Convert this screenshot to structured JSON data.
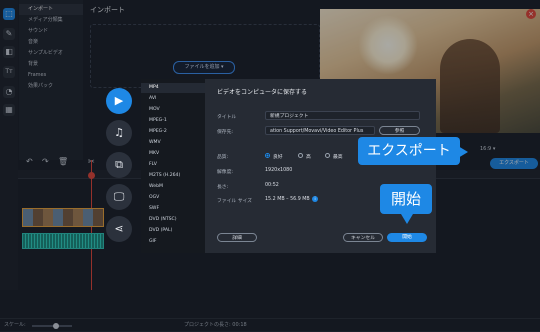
{
  "rail": {
    "items": [
      {
        "icon": "import-icon",
        "glyph": "⬚"
      },
      {
        "icon": "magic-icon",
        "glyph": "✎"
      },
      {
        "icon": "filter-icon",
        "glyph": "◧"
      },
      {
        "icon": "text-icon",
        "glyph": "Tт"
      },
      {
        "icon": "sticker-icon",
        "glyph": "◔"
      },
      {
        "icon": "more-icon",
        "glyph": "▦"
      }
    ]
  },
  "categories": [
    "インポート",
    "メディア分類集",
    "サウンド",
    "音楽",
    "サンプルビデオ",
    "背景",
    "Frames",
    "効果パック"
  ],
  "import": {
    "title": "インポート",
    "add_file": "ファイルを追加 ▾"
  },
  "timeline": {
    "tools": [
      "↶",
      "↷",
      "🗑",
      "✂"
    ],
    "ratio": "16:9 ▾",
    "export_label": "エクスポート",
    "scale_label": "スケール:",
    "duration_label": "プロジェクトの長さ: 00:18"
  },
  "dialog": {
    "export_types": [
      {
        "icon": "video-icon",
        "glyph": "▶"
      },
      {
        "icon": "music-icon",
        "glyph": "♫"
      },
      {
        "icon": "devices-icon",
        "glyph": "⧉"
      },
      {
        "icon": "monitor-icon",
        "glyph": "🖵"
      },
      {
        "icon": "share-icon",
        "glyph": "⋖"
      }
    ],
    "formats": [
      "MP4",
      "AVI",
      "MOV",
      "MPEG-1",
      "MPEG-2",
      "WMV",
      "MKV",
      "FLV",
      "M2TS (H.264)",
      "WebM",
      "OGV",
      "SWF",
      "DVD (NTSC)",
      "DVD (PAL)",
      "GIF"
    ],
    "title": "ビデオをコンピュータに保存する",
    "title_label": "タイトル",
    "title_value": "新規プロジェクト",
    "save_to_label": "保存先:",
    "save_to_value": "ation Support/Movavi/Video Editor Plus",
    "browse": "参照",
    "quality_label": "品質:",
    "quality_options": [
      "良好",
      "高",
      "最高"
    ],
    "resolution_label": "解像度:",
    "resolution_value": "1920x1080",
    "length_label": "長さ:",
    "length_value": "00:52",
    "filesize_label": "ファイル サイズ",
    "filesize_value": "15.2 MB – 56.9 MB",
    "details": "詳細",
    "cancel": "キャンセル",
    "start": "開始"
  },
  "callouts": {
    "export": "エクスポート",
    "start": "開始"
  }
}
